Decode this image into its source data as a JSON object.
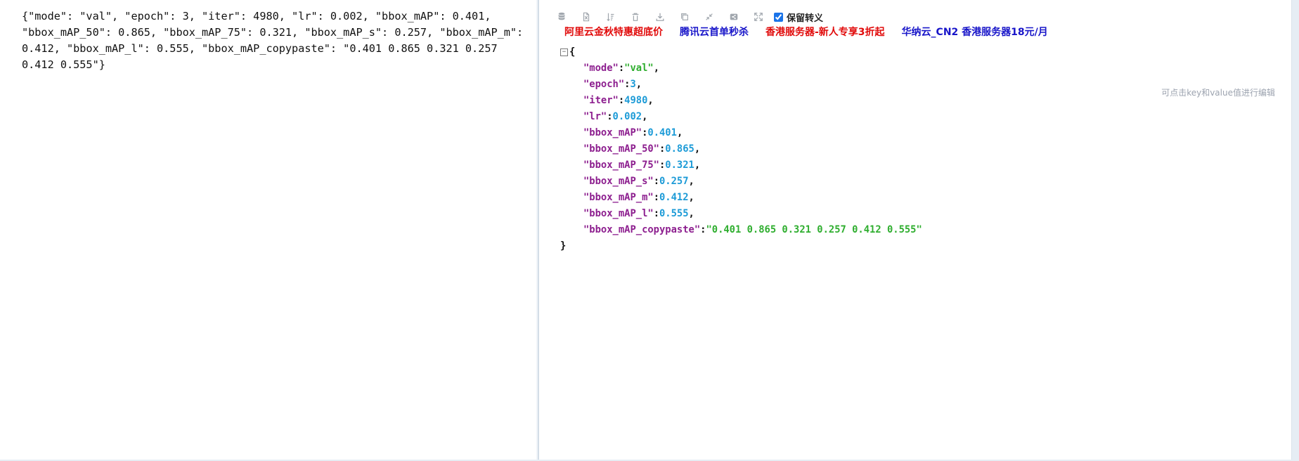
{
  "left_panel": {
    "raw_json": "{\"mode\": \"val\", \"epoch\": 3, \"iter\": 4980, \"lr\": 0.002, \"bbox_mAP\": 0.401, \"bbox_mAP_50\": 0.865, \"bbox_mAP_75\": 0.321, \"bbox_mAP_s\": 0.257, \"bbox_mAP_m\": 0.412, \"bbox_mAP_l\": 0.555, \"bbox_mAP_copypaste\": \"0.401 0.865 0.321 0.257 0.412 0.555\"}"
  },
  "toolbar": {
    "icons": [
      "database-icon",
      "excel-icon",
      "sort-icon",
      "trash-icon",
      "download-icon",
      "copy-icon",
      "compress-icon",
      "share-icon",
      "fullscreen-icon"
    ],
    "keep_escape_label": "保留转义",
    "keep_escape_checked": true
  },
  "ads": [
    {
      "label": "阿里云金秋特惠超底价",
      "color": "#e10b0b"
    },
    {
      "label": "腾讯云首单秒杀",
      "color": "#1815c9"
    },
    {
      "label": "香港服务器-新人专享3折起",
      "color": "#e10b0b"
    },
    {
      "label": "华纳云_CN2 香港服务器18元/月",
      "color": "#1815c9"
    }
  ],
  "hint": "可点击key和value值进行编辑",
  "json_view": {
    "open_brace": "{",
    "close_brace": "}",
    "collapse_symbol": "−",
    "lines": [
      {
        "key": "\"mode\"",
        "value": "\"val\"",
        "type": "string",
        "comma": ","
      },
      {
        "key": "\"epoch\"",
        "value": "3",
        "type": "number",
        "comma": ","
      },
      {
        "key": "\"iter\"",
        "value": "4980",
        "type": "number",
        "comma": ","
      },
      {
        "key": "\"lr\"",
        "value": "0.002",
        "type": "number",
        "comma": ","
      },
      {
        "key": "\"bbox_mAP\"",
        "value": "0.401",
        "type": "number",
        "comma": ","
      },
      {
        "key": "\"bbox_mAP_50\"",
        "value": "0.865",
        "type": "number",
        "comma": ","
      },
      {
        "key": "\"bbox_mAP_75\"",
        "value": "0.321",
        "type": "number",
        "comma": ","
      },
      {
        "key": "\"bbox_mAP_s\"",
        "value": "0.257",
        "type": "number",
        "comma": ","
      },
      {
        "key": "\"bbox_mAP_m\"",
        "value": "0.412",
        "type": "number",
        "comma": ","
      },
      {
        "key": "\"bbox_mAP_l\"",
        "value": "0.555",
        "type": "number",
        "comma": ","
      },
      {
        "key": "\"bbox_mAP_copypaste\"",
        "value": "\"0.401 0.865 0.321 0.257 0.412 0.555\"",
        "type": "string",
        "comma": ""
      }
    ]
  }
}
